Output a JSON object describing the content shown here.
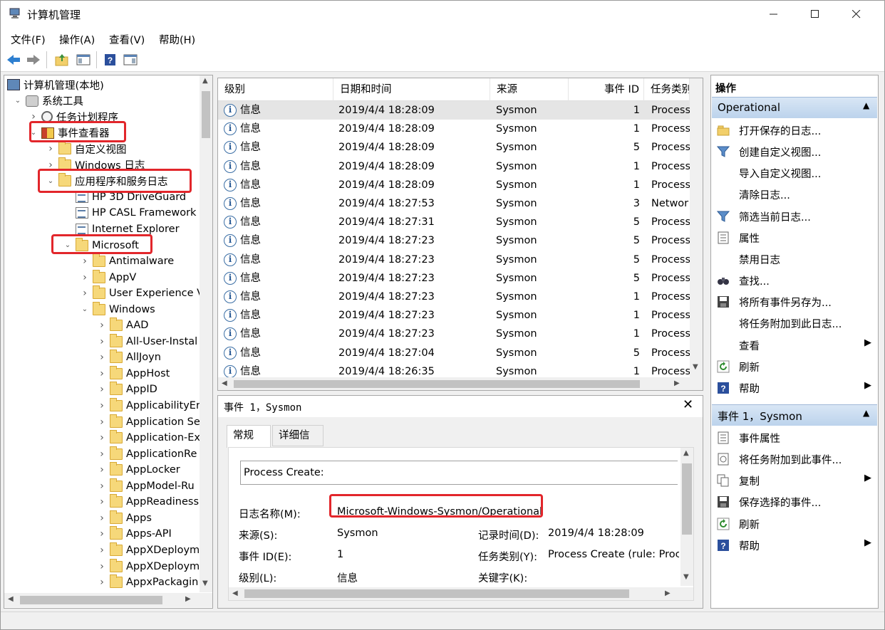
{
  "window": {
    "title": "计算机管理"
  },
  "menu": [
    "文件(F)",
    "操作(A)",
    "查看(V)",
    "帮助(H)"
  ],
  "tree": [
    {
      "label": "计算机管理(本地)",
      "depth": 0,
      "arrow": "",
      "icon": "computer-icon"
    },
    {
      "label": "系统工具",
      "depth": 1,
      "arrow": "v",
      "icon": "tools-icon"
    },
    {
      "label": "任务计划程序",
      "depth": 2,
      "arrow": ">",
      "icon": "clock-icon"
    },
    {
      "label": "事件查看器",
      "depth": 2,
      "arrow": "v",
      "icon": "event-viewer-icon"
    },
    {
      "label": "自定义视图",
      "depth": 3,
      "arrow": ">",
      "icon": "folder-icon"
    },
    {
      "label": "Windows 日志",
      "depth": 3,
      "arrow": ">",
      "icon": "folder-icon"
    },
    {
      "label": "应用程序和服务日志",
      "depth": 3,
      "arrow": "v",
      "icon": "folder-icon"
    },
    {
      "label": "HP 3D DriveGuard",
      "depth": 4,
      "arrow": "",
      "icon": "log-icon"
    },
    {
      "label": "HP CASL Framework",
      "depth": 4,
      "arrow": "",
      "icon": "log-icon"
    },
    {
      "label": "Internet Explorer",
      "depth": 4,
      "arrow": "",
      "icon": "log-icon"
    },
    {
      "label": "Microsoft",
      "depth": 4,
      "arrow": "v",
      "icon": "folder-icon"
    },
    {
      "label": "Antimalware",
      "depth": 5,
      "arrow": ">",
      "icon": "folder-icon"
    },
    {
      "label": "AppV",
      "depth": 5,
      "arrow": ">",
      "icon": "folder-icon"
    },
    {
      "label": "User Experience V",
      "depth": 5,
      "arrow": ">",
      "icon": "folder-icon"
    },
    {
      "label": "Windows",
      "depth": 5,
      "arrow": "v",
      "icon": "folder-icon"
    },
    {
      "label": "AAD",
      "depth": 6,
      "arrow": ">",
      "icon": "folder-icon"
    },
    {
      "label": "All-User-Instal",
      "depth": 6,
      "arrow": ">",
      "icon": "folder-icon"
    },
    {
      "label": "AllJoyn",
      "depth": 6,
      "arrow": ">",
      "icon": "folder-icon"
    },
    {
      "label": "AppHost",
      "depth": 6,
      "arrow": ">",
      "icon": "folder-icon"
    },
    {
      "label": "AppID",
      "depth": 6,
      "arrow": ">",
      "icon": "folder-icon"
    },
    {
      "label": "ApplicabilityEr",
      "depth": 6,
      "arrow": ">",
      "icon": "folder-icon"
    },
    {
      "label": "Application Se",
      "depth": 6,
      "arrow": ">",
      "icon": "folder-icon"
    },
    {
      "label": "Application-Ex",
      "depth": 6,
      "arrow": ">",
      "icon": "folder-icon"
    },
    {
      "label": "ApplicationRe",
      "depth": 6,
      "arrow": ">",
      "icon": "folder-icon"
    },
    {
      "label": "AppLocker",
      "depth": 6,
      "arrow": ">",
      "icon": "folder-icon"
    },
    {
      "label": "AppModel-Ru",
      "depth": 6,
      "arrow": ">",
      "icon": "folder-icon"
    },
    {
      "label": "AppReadiness",
      "depth": 6,
      "arrow": ">",
      "icon": "folder-icon"
    },
    {
      "label": "Apps",
      "depth": 6,
      "arrow": ">",
      "icon": "folder-icon"
    },
    {
      "label": "Apps-API",
      "depth": 6,
      "arrow": ">",
      "icon": "folder-icon"
    },
    {
      "label": "AppXDeploym",
      "depth": 6,
      "arrow": ">",
      "icon": "folder-icon"
    },
    {
      "label": "AppXDeploym",
      "depth": 6,
      "arrow": ">",
      "icon": "folder-icon"
    },
    {
      "label": "AppxPackagin",
      "depth": 6,
      "arrow": ">",
      "icon": "folder-icon"
    }
  ],
  "list": {
    "columns": [
      "级别",
      "日期和时间",
      "来源",
      "事件 ID",
      "任务类别"
    ],
    "rows": [
      {
        "level": "信息",
        "datetime": "2019/4/4 18:28:09",
        "source": "Sysmon",
        "event_id": "1",
        "task": "Process"
      },
      {
        "level": "信息",
        "datetime": "2019/4/4 18:28:09",
        "source": "Sysmon",
        "event_id": "1",
        "task": "Process"
      },
      {
        "level": "信息",
        "datetime": "2019/4/4 18:28:09",
        "source": "Sysmon",
        "event_id": "5",
        "task": "Process"
      },
      {
        "level": "信息",
        "datetime": "2019/4/4 18:28:09",
        "source": "Sysmon",
        "event_id": "1",
        "task": "Process"
      },
      {
        "level": "信息",
        "datetime": "2019/4/4 18:28:09",
        "source": "Sysmon",
        "event_id": "1",
        "task": "Process"
      },
      {
        "level": "信息",
        "datetime": "2019/4/4 18:27:53",
        "source": "Sysmon",
        "event_id": "3",
        "task": "Networ"
      },
      {
        "level": "信息",
        "datetime": "2019/4/4 18:27:31",
        "source": "Sysmon",
        "event_id": "5",
        "task": "Process"
      },
      {
        "level": "信息",
        "datetime": "2019/4/4 18:27:23",
        "source": "Sysmon",
        "event_id": "5",
        "task": "Process"
      },
      {
        "level": "信息",
        "datetime": "2019/4/4 18:27:23",
        "source": "Sysmon",
        "event_id": "5",
        "task": "Process"
      },
      {
        "level": "信息",
        "datetime": "2019/4/4 18:27:23",
        "source": "Sysmon",
        "event_id": "5",
        "task": "Process"
      },
      {
        "level": "信息",
        "datetime": "2019/4/4 18:27:23",
        "source": "Sysmon",
        "event_id": "1",
        "task": "Process"
      },
      {
        "level": "信息",
        "datetime": "2019/4/4 18:27:23",
        "source": "Sysmon",
        "event_id": "1",
        "task": "Process"
      },
      {
        "level": "信息",
        "datetime": "2019/4/4 18:27:23",
        "source": "Sysmon",
        "event_id": "1",
        "task": "Process"
      },
      {
        "level": "信息",
        "datetime": "2019/4/4 18:27:04",
        "source": "Sysmon",
        "event_id": "5",
        "task": "Process"
      },
      {
        "level": "信息",
        "datetime": "2019/4/4 18:26:35",
        "source": "Sysmon",
        "event_id": "1",
        "task": "Process"
      }
    ]
  },
  "detail": {
    "title": "事件 1，Sysmon",
    "tabs": [
      "常规",
      "详细信息"
    ],
    "description": "Process Create:",
    "log_name_label": "日志名称(M):",
    "log_name_value": "Microsoft-Windows-Sysmon/Operational",
    "source_label": "来源(S):",
    "source_value": "Sysmon",
    "logged_label": "记录时间(D):",
    "logged_value": "2019/4/4 18:28:09",
    "event_id_label": "事件 ID(E):",
    "event_id_value": "1",
    "task_label": "任务类别(Y):",
    "task_value": "Process Create (rule: Proce",
    "level_label": "级别(L):",
    "level_value": "信息",
    "keywords_label": "关键字(K):"
  },
  "actions": {
    "title": "操作",
    "section1": "Operational",
    "items1": [
      {
        "label": "打开保存的日志...",
        "icon": "open-folder-icon",
        "sub": false
      },
      {
        "label": "创建自定义视图...",
        "icon": "filter-icon",
        "sub": false
      },
      {
        "label": "导入自定义视图...",
        "icon": "",
        "sub": false
      },
      {
        "label": "清除日志...",
        "icon": "",
        "sub": false
      },
      {
        "label": "筛选当前日志...",
        "icon": "filter-icon",
        "sub": false
      },
      {
        "label": "属性",
        "icon": "properties-icon",
        "sub": false
      },
      {
        "label": "禁用日志",
        "icon": "",
        "sub": false
      },
      {
        "label": "查找...",
        "icon": "binoculars-icon",
        "sub": false
      },
      {
        "label": "将所有事件另存为...",
        "icon": "save-icon",
        "sub": false
      },
      {
        "label": "将任务附加到此日志...",
        "icon": "",
        "sub": false
      },
      {
        "label": "查看",
        "icon": "",
        "sub": true
      },
      {
        "label": "刷新",
        "icon": "refresh-icon",
        "sub": false
      },
      {
        "label": "帮助",
        "icon": "help-icon",
        "sub": true
      }
    ],
    "section2": "事件 1，Sysmon",
    "items2": [
      {
        "label": "事件属性",
        "icon": "properties-icon",
        "sub": false
      },
      {
        "label": "将任务附加到此事件...",
        "icon": "task-icon",
        "sub": false
      },
      {
        "label": "复制",
        "icon": "copy-icon",
        "sub": true
      },
      {
        "label": "保存选择的事件...",
        "icon": "save-icon",
        "sub": false
      },
      {
        "label": "刷新",
        "icon": "refresh-icon",
        "sub": false
      },
      {
        "label": "帮助",
        "icon": "help-icon",
        "sub": true
      }
    ]
  },
  "colors": {
    "accent": "#3a6ea5",
    "annotation": "#e2262b",
    "section_bg": "#c9dcf0"
  }
}
